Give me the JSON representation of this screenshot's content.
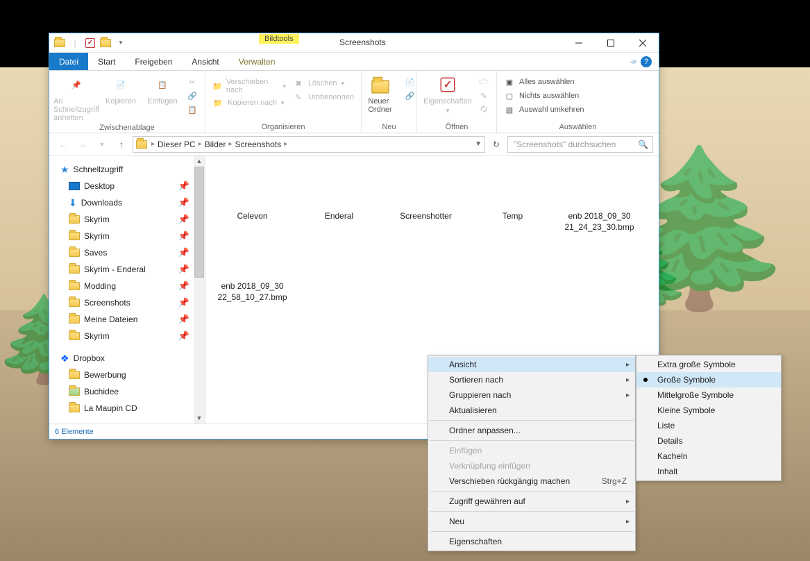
{
  "title_section_label": "Bildtools",
  "window_title": "Screenshots",
  "tabs": {
    "file": "Datei",
    "start": "Start",
    "share": "Freigeben",
    "view": "Ansicht",
    "manage": "Verwalten"
  },
  "ribbon": {
    "group1_name": "Zwischenablage",
    "pin_to": "An Schnellzugriff\nanheften",
    "copy": "Kopieren",
    "paste": "Einfügen",
    "group2_name": "Organisieren",
    "move_to": "Verschieben nach",
    "copy_to": "Kopieren nach",
    "delete": "Löschen",
    "rename": "Umbenennen",
    "group3_name": "Neu",
    "new_folder": "Neuer\nOrdner",
    "group4_name": "Öffnen",
    "properties": "Eigenschaften",
    "group5_name": "Auswählen",
    "select_all": "Alles auswählen",
    "select_none": "Nichts auswählen",
    "invert_sel": "Auswahl umkehren"
  },
  "breadcrumb": {
    "c1": "Dieser PC",
    "c2": "Bilder",
    "c3": "Screenshots"
  },
  "search_placeholder": "\"Screenshots\" durchsuchen",
  "nav": {
    "quick": "Schnellzugriff",
    "desktop": "Desktop",
    "downloads": "Downloads",
    "skyrim1": "Skyrim",
    "skyrim2": "Skyrim",
    "saves": "Saves",
    "enderal": "Skyrim - Enderal",
    "modding": "Modding",
    "screenshots": "Screenshots",
    "meine": "Meine Dateien",
    "skyrim3": "Skyrim",
    "dropbox": "Dropbox",
    "bewerbung": "Bewerbung",
    "buchidee": "Buchidee",
    "lamaupin": "La Maupin CD"
  },
  "files": {
    "f1": "Celevon",
    "f2": "Enderal",
    "f3": "Screenshotter",
    "f4": "Temp",
    "f5": "enb 2018_09_30 21_24_23_30.bmp",
    "f6": "enb 2018_09_30 22_58_10_27.bmp"
  },
  "status": "6 Elemente",
  "ctx": {
    "view": "Ansicht",
    "sort": "Sortieren nach",
    "group": "Gruppieren nach",
    "refresh": "Aktualisieren",
    "customize": "Ordner anpassen...",
    "paste": "Einfügen",
    "pastelink": "Verknüpfung einfügen",
    "undo": "Verschieben rückgängig machen",
    "undo_short": "Strg+Z",
    "grant": "Zugriff gewähren auf",
    "new": "Neu",
    "props": "Eigenschaften"
  },
  "submenu": {
    "xl": "Extra große Symbole",
    "lg": "Große Symbole",
    "md": "Mittelgroße Symbole",
    "sm": "Kleine Symbole",
    "list": "Liste",
    "details": "Details",
    "tiles": "Kacheln",
    "content": "Inhalt"
  }
}
